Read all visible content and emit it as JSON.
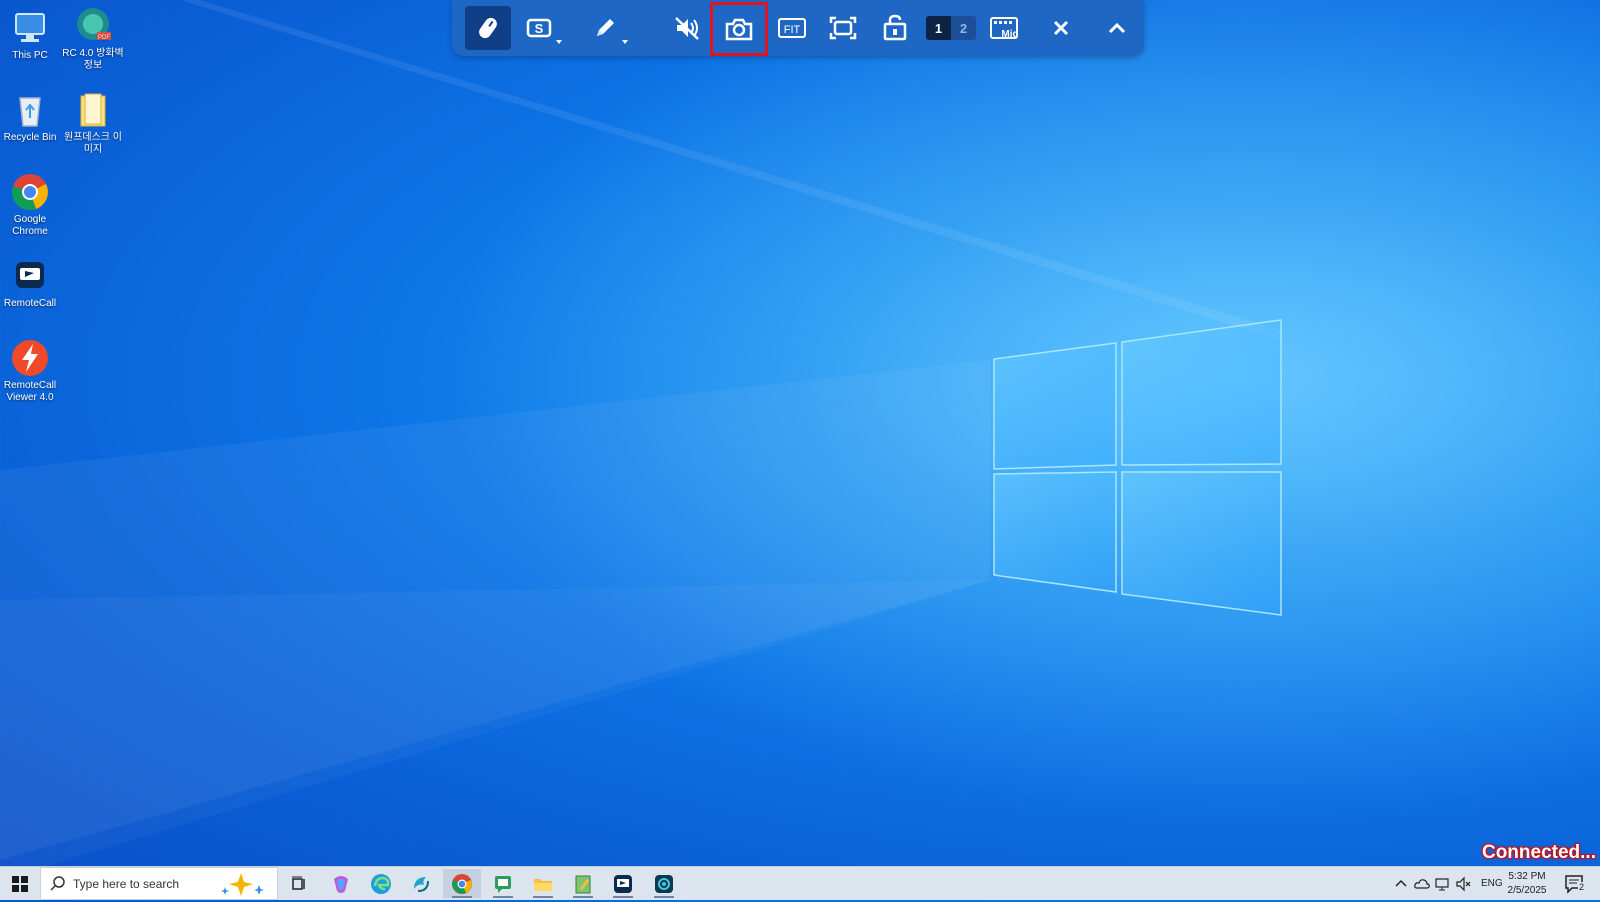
{
  "desktop_icons": [
    {
      "label": "This PC",
      "icon": "this-pc-icon"
    },
    {
      "label": "RC 4.0 방화벽 정보",
      "icon": "pdf-file-icon"
    },
    {
      "label": "Recycle Bin",
      "icon": "recycle-bin-icon"
    },
    {
      "label": "원프데스크 이미지",
      "icon": "folder-icon"
    },
    {
      "label": "Google Chrome",
      "icon": "chrome-icon"
    },
    {
      "label": "RemoteCall",
      "icon": "remotecall-icon"
    },
    {
      "label": "RemoteCall Viewer 4.0",
      "icon": "remotecall-viewer-icon"
    }
  ],
  "toolbar": {
    "fit_label": "FIT",
    "monitor_1": "1",
    "monitor_2": "2",
    "keyboard_label": "Mid"
  },
  "status": {
    "connected_text": "Connected..."
  },
  "taskbar": {
    "search_placeholder": "Type here to search",
    "language": "ENG",
    "time": "5:32 PM",
    "date": "2/5/2025",
    "notification_count": "2"
  },
  "colors": {
    "toolbar_bg": "#1f67c4",
    "highlight_border": "#e0141e",
    "connected_text": "#c1121b"
  }
}
